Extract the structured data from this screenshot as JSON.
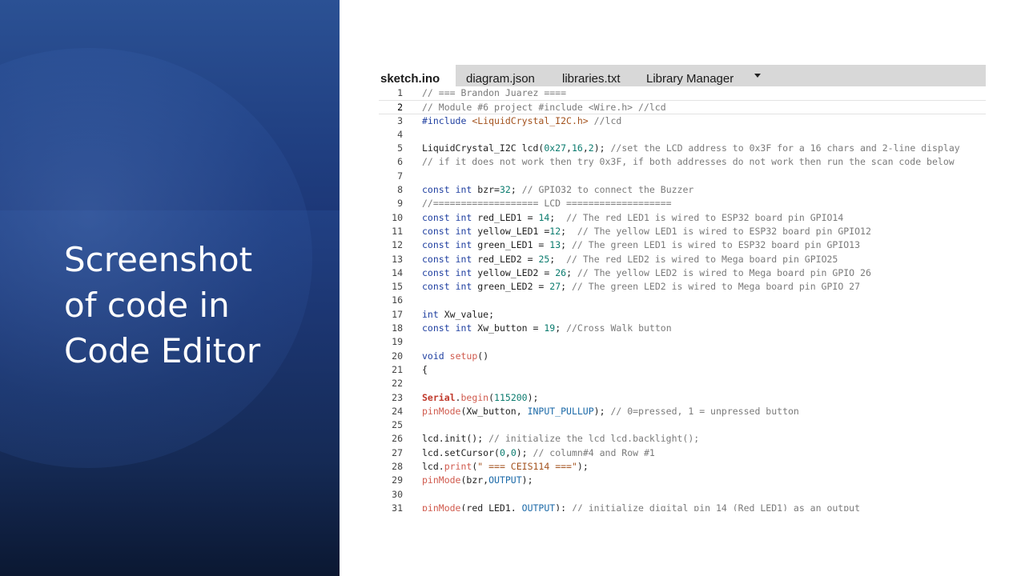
{
  "slide": {
    "title": "Screenshot\nof code in\nCode Editor"
  },
  "colors": {
    "panel_top": "#2c5296",
    "panel_bottom": "#0b1832",
    "tab_bar": "#d8d8d8",
    "comment": "#7a7a7a",
    "keyword": "#1f3fa0",
    "function": "#d05a4d",
    "number": "#0a7b6e",
    "string": "#a3521d"
  },
  "editor": {
    "tabs": [
      {
        "label": "sketch.ino",
        "active": true
      },
      {
        "label": "diagram.json",
        "active": false
      },
      {
        "label": "libraries.txt",
        "active": false
      },
      {
        "label": "Library Manager",
        "active": false
      }
    ],
    "dropdown_icon": "caret-down-icon",
    "current_line": 2,
    "lines": [
      {
        "n": "1",
        "text": "// === Brandon Juarez ===="
      },
      {
        "n": "2",
        "text": "// Module #6 project #include <Wire.h> //lcd"
      },
      {
        "n": "3",
        "text": "#include <LiquidCrystal_I2C.h> //lcd"
      },
      {
        "n": "4",
        "text": ""
      },
      {
        "n": "5",
        "text": "LiquidCrystal_I2C lcd(0x27,16,2); //set the LCD address to 0x3F for a 16 chars and 2-line display"
      },
      {
        "n": "6",
        "text": "// if it does not work then try 0x3F, if both addresses do not work then run the scan code below"
      },
      {
        "n": "7",
        "text": ""
      },
      {
        "n": "8",
        "text": "const int bzr=32; // GPIO32 to connect the Buzzer"
      },
      {
        "n": "9",
        "text": "//=================== LCD ==================="
      },
      {
        "n": "10",
        "text": "const int red_LED1 = 14;  // The red LED1 is wired to ESP32 board pin GPIO14"
      },
      {
        "n": "11",
        "text": "const int yellow_LED1 =12;  // The yellow LED1 is wired to ESP32 board pin GPIO12"
      },
      {
        "n": "12",
        "text": "const int green_LED1 = 13; // The green LED1 is wired to ESP32 board pin GPIO13"
      },
      {
        "n": "13",
        "text": "const int red_LED2 = 25;  // The red LED2 is wired to Mega board pin GPIO25"
      },
      {
        "n": "14",
        "text": "const int yellow_LED2 = 26; // The yellow LED2 is wired to Mega board pin GPIO 26"
      },
      {
        "n": "15",
        "text": "const int green_LED2 = 27; // The green LED2 is wired to Mega board pin GPIO 27"
      },
      {
        "n": "16",
        "text": ""
      },
      {
        "n": "17",
        "text": "int Xw_value;"
      },
      {
        "n": "18",
        "text": "const int Xw_button = 19; //Cross Walk button"
      },
      {
        "n": "19",
        "text": ""
      },
      {
        "n": "20",
        "text": "void setup()"
      },
      {
        "n": "21",
        "text": "{"
      },
      {
        "n": "22",
        "text": ""
      },
      {
        "n": "23",
        "text": "Serial.begin(115200);"
      },
      {
        "n": "24",
        "text": "pinMode(Xw_button, INPUT_PULLUP); // 0=pressed, 1 = unpressed button"
      },
      {
        "n": "25",
        "text": ""
      },
      {
        "n": "26",
        "text": "lcd.init(); // initialize the lcd lcd.backlight();"
      },
      {
        "n": "27",
        "text": "lcd.setCursor(0,0); // column#4 and Row #1"
      },
      {
        "n": "28",
        "text": "lcd.print(\" === CEIS114 ===\");"
      },
      {
        "n": "29",
        "text": "pinMode(bzr,OUTPUT);"
      },
      {
        "n": "30",
        "text": ""
      },
      {
        "n": "31",
        "text": "pinMode(red_LED1, OUTPUT); // initialize digital pin 14 (Red LED1) as an output"
      }
    ]
  }
}
